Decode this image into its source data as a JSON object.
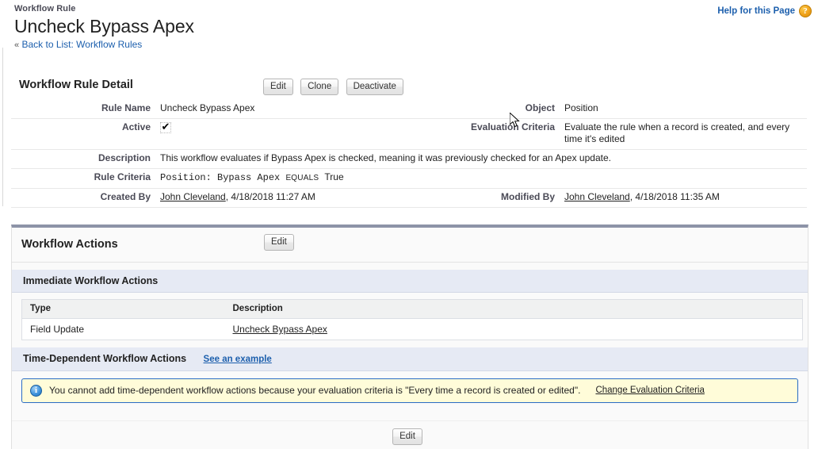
{
  "header": {
    "eyebrow": "Workflow Rule",
    "title": "Uncheck Bypass Apex",
    "back_chevron": "«",
    "back_prefix": "Back to List: ",
    "back_link": "Workflow Rules",
    "help_label": "Help for this Page",
    "help_icon": "?"
  },
  "detail": {
    "section_title": "Workflow Rule Detail",
    "buttons": [
      {
        "label": "Edit"
      },
      {
        "label": "Clone"
      },
      {
        "label": "Deactivate"
      }
    ],
    "labels": {
      "rule_name": "Rule Name",
      "object": "Object",
      "active": "Active",
      "evaluation_criteria": "Evaluation Criteria",
      "description": "Description",
      "rule_criteria": "Rule Criteria",
      "created_by": "Created By",
      "modified_by": "Modified By"
    },
    "values": {
      "rule_name": "Uncheck Bypass Apex",
      "object": "Position",
      "active_check": "✔",
      "evaluation_criteria": "Evaluate the rule when a record is created, and every time it's edited",
      "description": "This workflow evaluates if Bypass Apex is checked, meaning it was previously checked for an Apex update.",
      "rule_criteria_field": "Position: Bypass Apex",
      "rule_criteria_operator": "EQUALS",
      "rule_criteria_value": "True",
      "created_by_user": "John Cleveland",
      "created_by_date": ", 4/18/2018 11:27 AM",
      "modified_by_user": "John Cleveland",
      "modified_by_date": ", 4/18/2018 11:35 AM"
    }
  },
  "actions": {
    "section_title": "Workflow Actions",
    "edit_label": "Edit",
    "immediate_heading": "Immediate Workflow Actions",
    "columns": [
      "Type",
      "Description"
    ],
    "rows": [
      {
        "type": "Field Update",
        "description": "Uncheck Bypass Apex"
      }
    ],
    "time_dependent_heading": "Time-Dependent Workflow Actions",
    "see_example_label": "See an example",
    "notice": {
      "icon": "i",
      "text": "You cannot add time-dependent workflow actions because your evaluation criteria is \"Every time a record is created or edited\".",
      "link_label": "Change Evaluation Criteria"
    },
    "footer_edit_label": "Edit"
  },
  "colors": {
    "link": "#1c5fad",
    "subhead_bg": "#e6eaf4",
    "notice_bg": "#fffcd9",
    "notice_border": "#2a6cc4",
    "panel_top_border": "#8d93a7",
    "help_icon": "#f0a21a",
    "info_icon": "#3f93dc"
  }
}
